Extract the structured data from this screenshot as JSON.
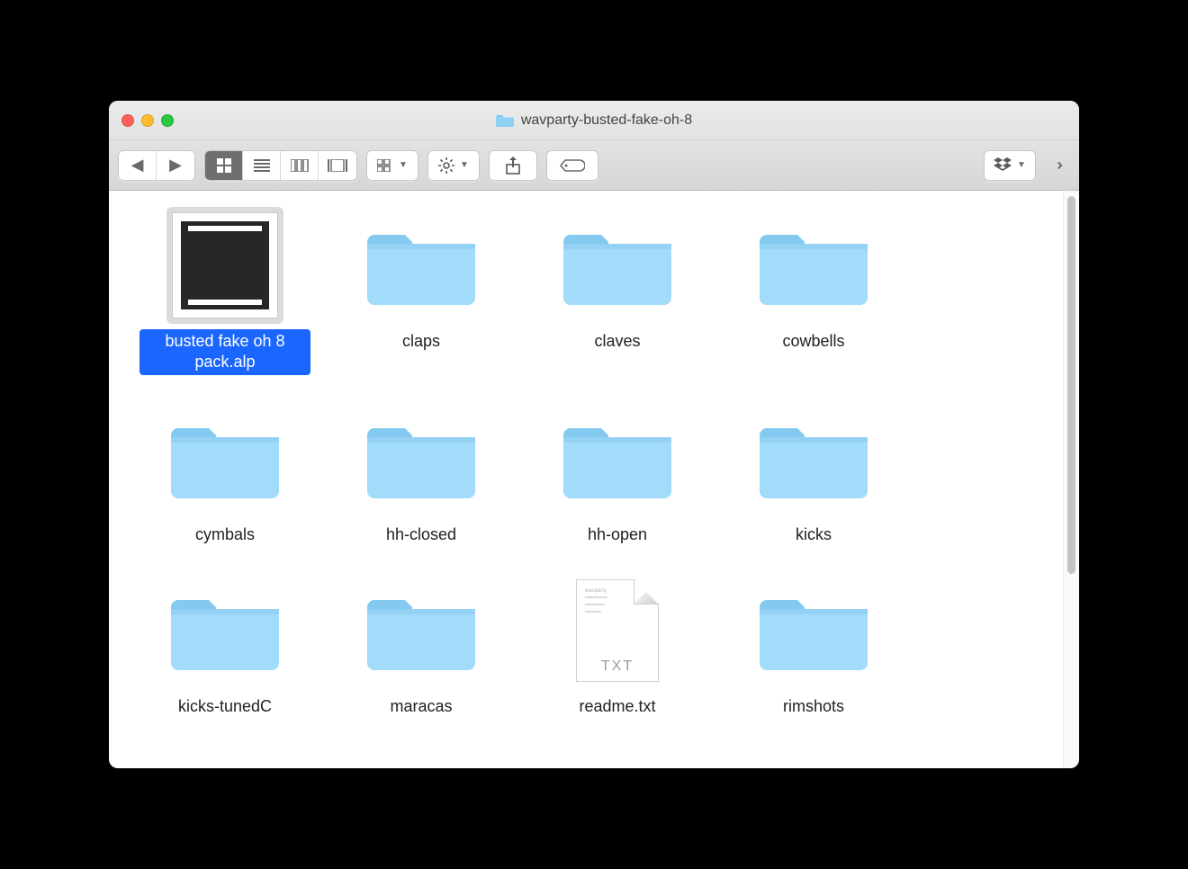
{
  "window": {
    "title": "wavparty-busted-fake-oh-8"
  },
  "items": [
    {
      "name": "busted fake oh 8 pack.alp",
      "kind": "alp",
      "selected": true
    },
    {
      "name": "claps",
      "kind": "folder",
      "selected": false
    },
    {
      "name": "claves",
      "kind": "folder",
      "selected": false
    },
    {
      "name": "cowbells",
      "kind": "folder",
      "selected": false
    },
    {
      "name": "cymbals",
      "kind": "folder",
      "selected": false
    },
    {
      "name": "hh-closed",
      "kind": "folder",
      "selected": false
    },
    {
      "name": "hh-open",
      "kind": "folder",
      "selected": false
    },
    {
      "name": "kicks",
      "kind": "folder",
      "selected": false
    },
    {
      "name": "kicks-tunedC",
      "kind": "folder",
      "selected": false
    },
    {
      "name": "maracas",
      "kind": "folder",
      "selected": false
    },
    {
      "name": "readme.txt",
      "kind": "txt",
      "selected": false
    },
    {
      "name": "rimshots",
      "kind": "folder",
      "selected": false
    }
  ],
  "txt_label": "TXT",
  "txt_header": "wavparty"
}
